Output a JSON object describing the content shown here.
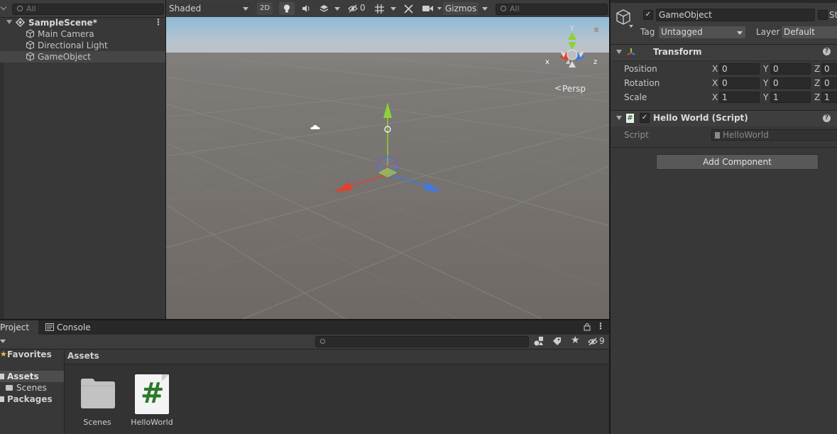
{
  "hierarchy": {
    "search_placeholder": "All",
    "scene_name": "SampleScene*",
    "items": [
      {
        "label": "Main Camera"
      },
      {
        "label": "Directional Light"
      },
      {
        "label": "GameObject"
      }
    ]
  },
  "scene_view": {
    "shading_mode": "Shaded",
    "mode_2d": "2D",
    "hidden_count": "0",
    "gizmos_label": "Gizmos",
    "search_placeholder": "All",
    "gizmo_axes": {
      "x": "x",
      "y": "y",
      "z": "z"
    },
    "projection_label": "Persp"
  },
  "project": {
    "tabs": [
      {
        "label": "Project"
      },
      {
        "label": "Console"
      }
    ],
    "hidden_count": "9",
    "favorites_label": "Favorites",
    "tree": [
      {
        "label": "Assets"
      },
      {
        "label": "Scenes"
      },
      {
        "label": "Packages"
      }
    ],
    "breadcrumb": "Assets",
    "assets": [
      {
        "label": "Scenes",
        "icon": "folder-icon"
      },
      {
        "label": "HelloWorld",
        "icon": "csharp-script-icon",
        "glyph": "#"
      }
    ]
  },
  "inspector": {
    "object_name": "GameObject",
    "static_label": "St",
    "tag_label": "Tag",
    "tag_value": "Untagged",
    "layer_label": "Layer",
    "layer_value": "Default",
    "transform": {
      "title": "Transform",
      "position_label": "Position",
      "rotation_label": "Rotation",
      "scale_label": "Scale",
      "axis_x": "X",
      "axis_y": "Y",
      "axis_z": "Z",
      "position": {
        "x": "0",
        "y": "0",
        "z": "0"
      },
      "rotation": {
        "x": "0",
        "y": "0",
        "z": "0"
      },
      "scale": {
        "x": "1",
        "y": "1",
        "z": "1"
      }
    },
    "script_component": {
      "title": "Hello World (Script)",
      "script_label": "Script",
      "script_value": "HelloWorld"
    },
    "add_component_label": "Add Component",
    "help_glyph": "?"
  },
  "colors": {
    "x_axis": "#e0412e",
    "y_axis": "#8cd13b",
    "z_axis": "#3f78e0",
    "panel_bg": "#383838",
    "selection": "#464646"
  }
}
